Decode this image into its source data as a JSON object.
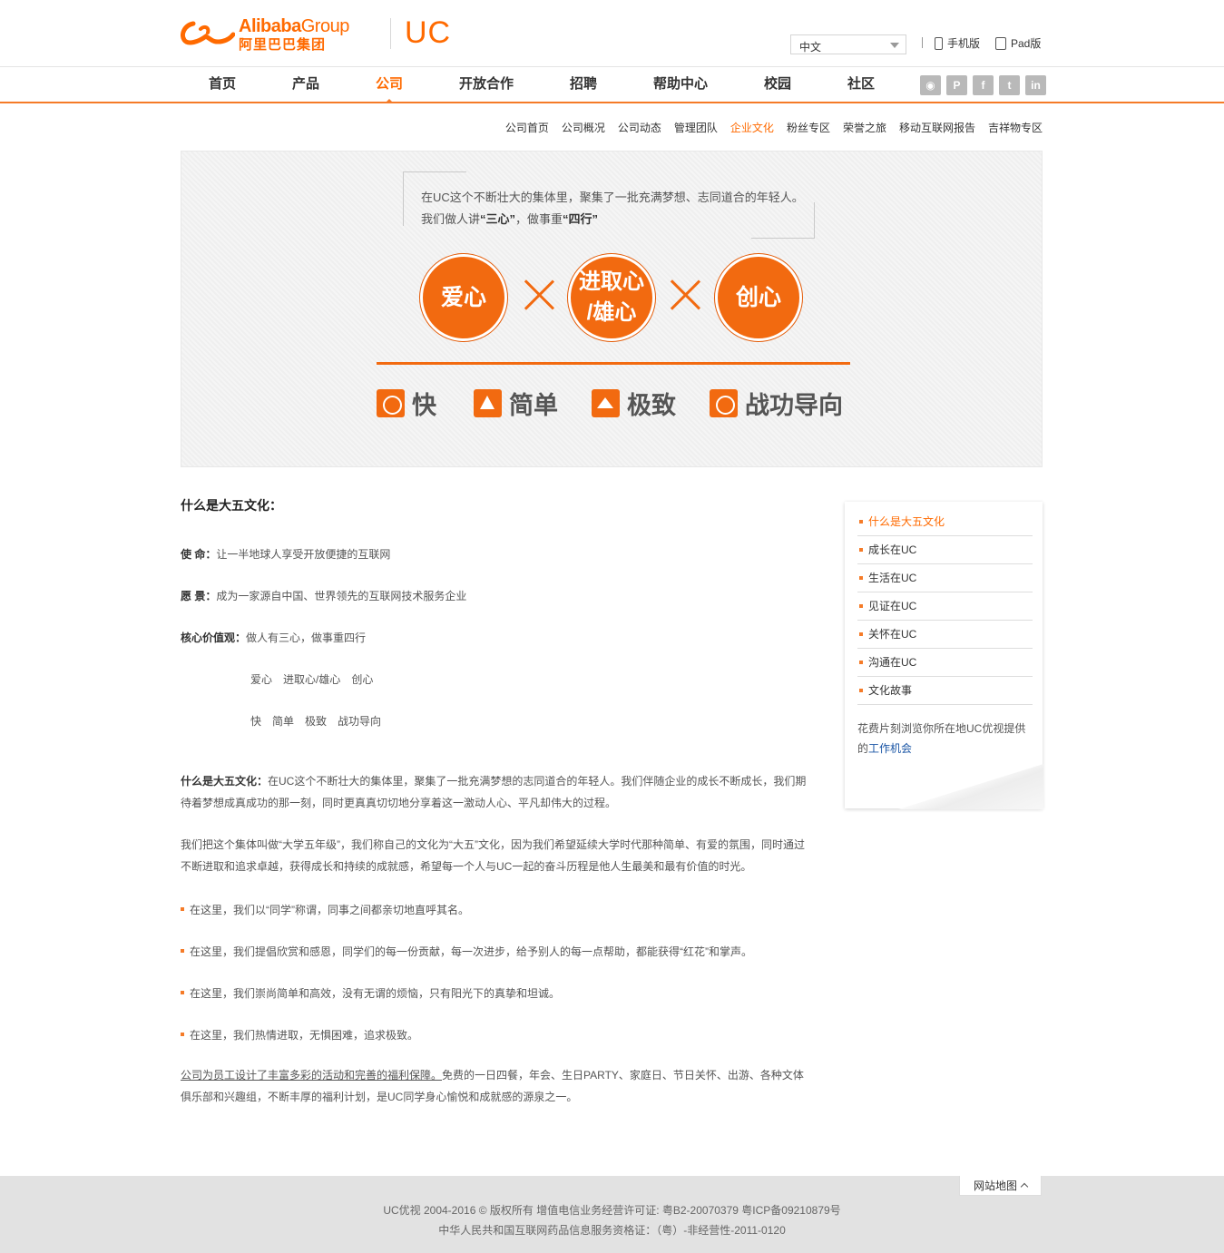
{
  "header": {
    "brand_en_bold": "Alibaba",
    "brand_en_light": "Group",
    "brand_cn": "阿里巴巴集团",
    "product_logo": "UC",
    "language": {
      "selected": "中文"
    },
    "mobile_label": "手机版",
    "pad_label": "Pad版"
  },
  "nav": {
    "items": [
      {
        "label": "首页",
        "active": false
      },
      {
        "label": "产品",
        "active": false
      },
      {
        "label": "公司",
        "active": true
      },
      {
        "label": "开放合作",
        "active": false
      },
      {
        "label": "招聘",
        "active": false
      },
      {
        "label": "帮助中心",
        "active": false
      },
      {
        "label": "校园",
        "active": false
      },
      {
        "label": "社区",
        "active": false
      }
    ],
    "social": [
      {
        "icon": "weibo-icon",
        "glyph": "◉"
      },
      {
        "icon": "pinterest-icon",
        "glyph": "P"
      },
      {
        "icon": "facebook-icon",
        "glyph": "f"
      },
      {
        "icon": "twitter-icon",
        "glyph": "t"
      },
      {
        "icon": "linkedin-icon",
        "glyph": "in"
      }
    ]
  },
  "subnav": {
    "items": [
      {
        "label": "公司首页",
        "active": false
      },
      {
        "label": "公司概况",
        "active": false
      },
      {
        "label": "公司动态",
        "active": false
      },
      {
        "label": "管理团队",
        "active": false
      },
      {
        "label": "企业文化",
        "active": true
      },
      {
        "label": "粉丝专区",
        "active": false
      },
      {
        "label": "荣誉之旅",
        "active": false
      },
      {
        "label": "移动互联网报告",
        "active": false
      },
      {
        "label": "吉祥物专区",
        "active": false
      }
    ]
  },
  "banner": {
    "quote_line1": "在UC这个不断壮大的集体里，聚集了一批充满梦想、志同道合的年轻人。",
    "quote_line2_pre": "我们做人讲",
    "quote_line2_b1": "“三心”",
    "quote_line2_mid": "，做事重",
    "quote_line2_b2": "“四行”",
    "hearts": [
      "爱心",
      "进取心\n/雄心",
      "创心"
    ],
    "actions": [
      {
        "label": "快",
        "icon": "speedometer-icon"
      },
      {
        "label": "简单",
        "icon": "network-icon"
      },
      {
        "label": "极致",
        "icon": "mountain-icon"
      },
      {
        "label": "战功导向",
        "icon": "medal-icon"
      }
    ],
    "accent": "#f26a10"
  },
  "article": {
    "title": "什么是大五文化：",
    "mission_label": "使 命：",
    "mission": "让一半地球人享受开放便捷的互联网",
    "vision_label": "愿 景：",
    "vision": "成为一家源自中国、世界领先的互联网技术服务企业",
    "values_label": "核心价值观：",
    "values": "做人有三心，做事重四行",
    "hearts_line": "爱心　进取心/雄心　创心",
    "actions_line": "快　简单　极致　战功导向",
    "p1_label": "什么是大五文化：",
    "p1": "在UC这个不断壮大的集体里，聚集了一批充满梦想的志同道合的年轻人。我们伴随企业的成长不断成长，我们期待着梦想成真成功的那一刻，同时更真真切切地分享着这一激动人心、平凡却伟大的过程。",
    "p2": "我们把这个集体叫做“大学五年级”，我们称自己的文化为“大五”文化，因为我们希望延续大学时代那种简单、有爱的氛围，同时通过不断进取和追求卓越，获得成长和持续的成就感，希望每一个人与UC一起的奋斗历程是他人生最美和最有价值的时光。",
    "bullets": [
      "在这里，我们以“同学”称谓，同事之间都亲切地直呼其名。",
      "在这里，我们提倡欣赏和感恩，同学们的每一份贡献，每一次进步，给予别人的每一点帮助，都能获得“红花”和掌声。",
      "在这里，我们崇尚简单和高效，没有无谓的烦恼，只有阳光下的真挚和坦诚。",
      "在这里，我们热情进取，无惧困难，追求极致。"
    ],
    "p3_link": "公司为员工设计了丰富多彩的活动和完善的福利保障。",
    "p3": "免费的一日四餐，年会、生日PARTY、家庭日、节日关怀、出游、各种文体俱乐部和兴趣组，不断丰厚的福利计划，是UC同学身心愉悦和成就感的源泉之一。"
  },
  "sidebar": {
    "items": [
      {
        "label": "什么是大五文化",
        "active": true
      },
      {
        "label": "成长在UC",
        "active": false
      },
      {
        "label": "生活在UC",
        "active": false
      },
      {
        "label": "见证在UC",
        "active": false
      },
      {
        "label": "关怀在UC",
        "active": false
      },
      {
        "label": "沟通在UC",
        "active": false
      },
      {
        "label": "文化故事",
        "active": false
      }
    ],
    "note_pre": "花费片刻浏览你所在地UC优视提供的",
    "note_link": "工作机会"
  },
  "footer": {
    "sitemap_label": "网站地图",
    "line1": "UC优视 2004-2016 © 版权所有 增值电信业务经营许可证: 粤B2-20070379 粤ICP备09210879号",
    "line2": "中华人民共和国互联网药品信息服务资格证：（粤）-非经营性-2011-0120"
  }
}
